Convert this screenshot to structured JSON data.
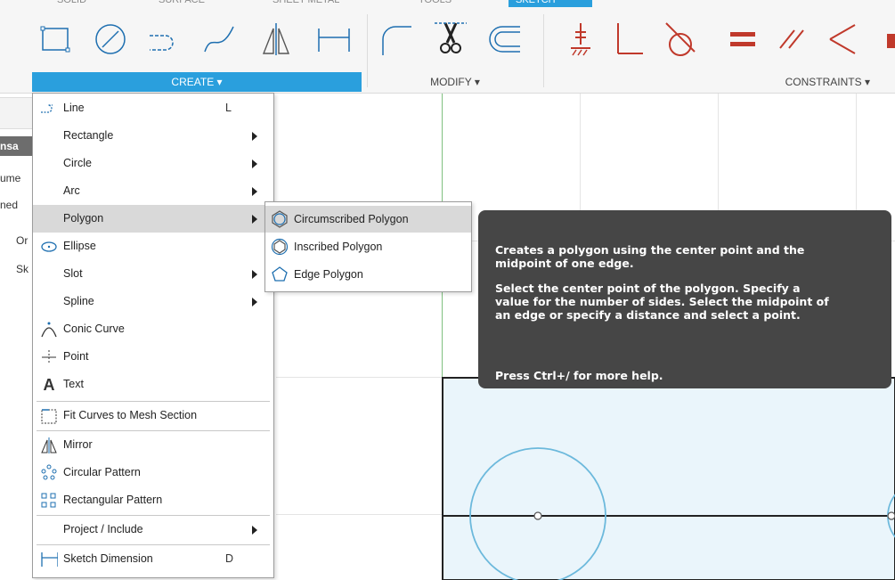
{
  "toolbar": {
    "top_tabs": [
      "SOLID",
      "SURFACE",
      "SHEET METAL",
      "TOOLS",
      "SKETCH"
    ],
    "groups": {
      "create": "CREATE ▾",
      "modify": "MODIFY ▾",
      "constraints": "CONSTRAINTS ▾"
    },
    "accent_color": "#2a9fdd"
  },
  "left_panel": {
    "items": [
      "nsa",
      "ume",
      "ned",
      "Or",
      "Sk"
    ]
  },
  "create_menu": {
    "items": [
      {
        "label": "Line",
        "shortcut": "L",
        "icon": "line-icon"
      },
      {
        "label": "Rectangle",
        "submenu": true
      },
      {
        "label": "Circle",
        "submenu": true
      },
      {
        "label": "Arc",
        "submenu": true
      },
      {
        "label": "Polygon",
        "submenu": true,
        "highlighted": true
      },
      {
        "label": "Ellipse",
        "icon": "ellipse-icon"
      },
      {
        "label": "Slot",
        "submenu": true
      },
      {
        "label": "Spline",
        "submenu": true
      },
      {
        "label": "Conic Curve",
        "icon": "conic-curve-icon"
      },
      {
        "label": "Point",
        "icon": "point-icon"
      },
      {
        "label": "Text",
        "icon": "text-icon"
      },
      {
        "label": "Fit Curves to Mesh Section",
        "icon": "fit-curves-icon"
      },
      {
        "label": "Mirror",
        "icon": "mirror-icon"
      },
      {
        "label": "Circular Pattern",
        "icon": "circular-pattern-icon"
      },
      {
        "label": "Rectangular Pattern",
        "icon": "rectangular-pattern-icon"
      },
      {
        "label": "Project / Include",
        "submenu": true
      },
      {
        "label": "Sketch Dimension",
        "shortcut": "D",
        "icon": "sketch-dimension-icon"
      }
    ]
  },
  "polygon_submenu": {
    "items": [
      {
        "label": "Circumscribed Polygon",
        "highlighted": true
      },
      {
        "label": "Inscribed Polygon"
      },
      {
        "label": "Edge Polygon"
      }
    ]
  },
  "tooltip": {
    "line1": "Creates a polygon using the center point and the",
    "line2": "midpoint of one edge.",
    "line3": "Select the center point of the polygon. Specify a",
    "line4": "value for the number of sides. Select the midpoint of",
    "line5": "an edge or specify a distance and select a point.",
    "line6": "Press Ctrl+/ for more help."
  }
}
